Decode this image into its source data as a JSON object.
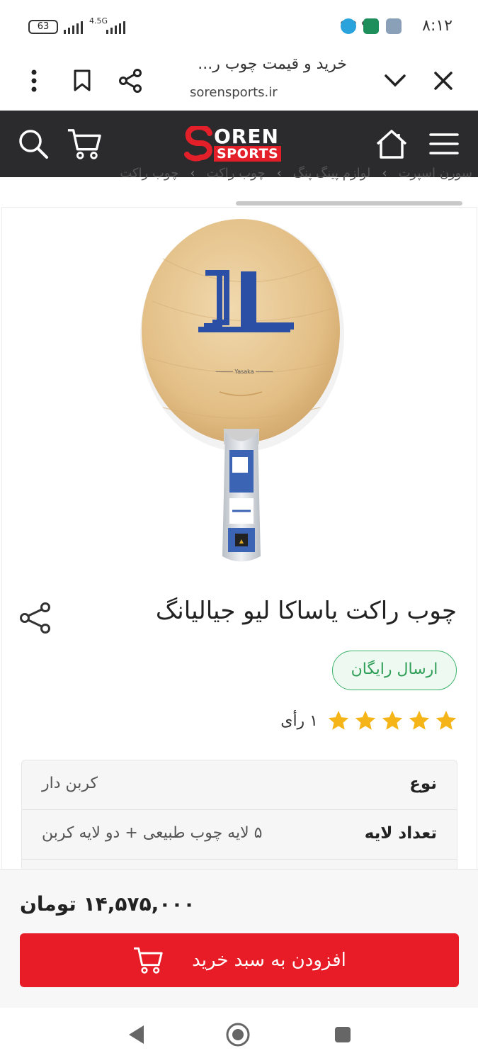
{
  "status_bar": {
    "time": "۸:۱۲",
    "battery": "63",
    "network": "4.5G"
  },
  "browser": {
    "title": "خرید و قیمت چوب ر...",
    "url": "sorensports.ir"
  },
  "site": {
    "logo_top": "OREN",
    "logo_bottom": "SPORTS",
    "accent": "#e3202a",
    "header_bg": "#2b2b2e"
  },
  "breadcrumb": [
    "سورن اسپرت",
    "لوازم پینگ پنگ",
    "چوب راکت",
    "چوب راکت"
  ],
  "product": {
    "title": "چوب راکت یاساکا لیو جیالیانگ",
    "free_shipping": "ارسال رایگان",
    "rating_stars": 5,
    "rating_count": "۱ رأی",
    "specs": [
      {
        "key": "نوع",
        "value": "کربن دار"
      },
      {
        "key": "تعداد لایه",
        "value": "۵ لایه چوب طبیعی + دو لایه کربن"
      }
    ],
    "price": "۱۴,۵۷۵,۰۰۰ تومان",
    "add_to_cart": "افزودن به سبد خرید"
  }
}
